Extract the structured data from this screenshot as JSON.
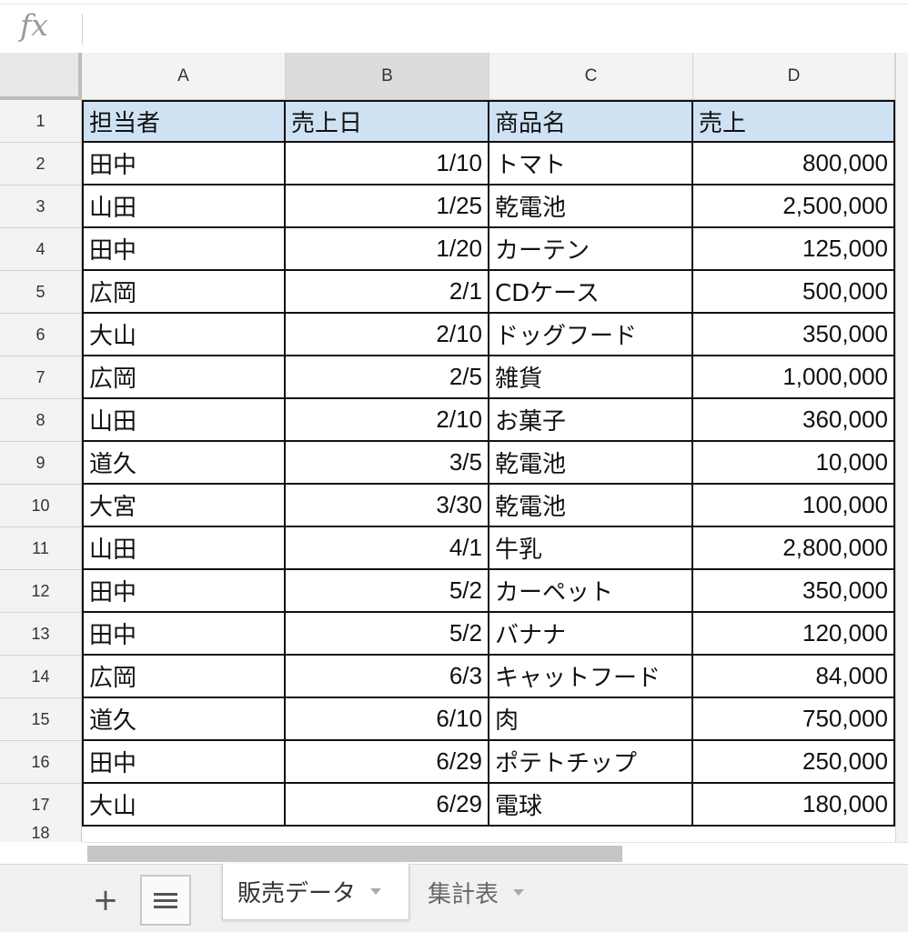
{
  "formula_bar": {
    "fx_label": "fx",
    "value": ""
  },
  "columns": [
    {
      "id": "A",
      "label": "A"
    },
    {
      "id": "B",
      "label": "B"
    },
    {
      "id": "C",
      "label": "C"
    },
    {
      "id": "D",
      "label": "D"
    }
  ],
  "rows": [
    {
      "num": "1",
      "cells": [
        "担当者",
        "売上日",
        "商品名",
        "売上"
      ]
    },
    {
      "num": "2",
      "cells": [
        "田中",
        "1/10",
        "トマト",
        "800,000"
      ]
    },
    {
      "num": "3",
      "cells": [
        "山田",
        "1/25",
        "乾電池",
        "2,500,000"
      ]
    },
    {
      "num": "4",
      "cells": [
        "田中",
        "1/20",
        "カーテン",
        "125,000"
      ]
    },
    {
      "num": "5",
      "cells": [
        "広岡",
        "2/1",
        "CDケース",
        "500,000"
      ]
    },
    {
      "num": "6",
      "cells": [
        "大山",
        "2/10",
        "ドッグフード",
        "350,000"
      ]
    },
    {
      "num": "7",
      "cells": [
        "広岡",
        "2/5",
        "雑貨",
        "1,000,000"
      ]
    },
    {
      "num": "8",
      "cells": [
        "山田",
        "2/10",
        "お菓子",
        "360,000"
      ]
    },
    {
      "num": "9",
      "cells": [
        "道久",
        "3/5",
        "乾電池",
        "10,000"
      ]
    },
    {
      "num": "10",
      "cells": [
        "大宮",
        "3/30",
        "乾電池",
        "100,000"
      ]
    },
    {
      "num": "11",
      "cells": [
        "山田",
        "4/1",
        "牛乳",
        "2,800,000"
      ]
    },
    {
      "num": "12",
      "cells": [
        "田中",
        "5/2",
        "カーペット",
        "350,000"
      ]
    },
    {
      "num": "13",
      "cells": [
        "田中",
        "5/2",
        "バナナ",
        "120,000"
      ]
    },
    {
      "num": "14",
      "cells": [
        "広岡",
        "6/3",
        "キャットフード",
        "84,000"
      ]
    },
    {
      "num": "15",
      "cells": [
        "道久",
        "6/10",
        "肉",
        "750,000"
      ]
    },
    {
      "num": "16",
      "cells": [
        "田中",
        "6/29",
        "ポテトチップ",
        "250,000"
      ]
    },
    {
      "num": "17",
      "cells": [
        "大山",
        "6/29",
        "電球",
        "180,000"
      ]
    }
  ],
  "extra_row_label": "18",
  "sheet_bar": {
    "add_label": "+",
    "tabs": [
      {
        "label": "販売データ",
        "active": true
      },
      {
        "label": "集計表",
        "active": false
      }
    ]
  },
  "colors": {
    "header_fill": "#cfe2f3",
    "selected_column_header": "#dcdcdc"
  }
}
